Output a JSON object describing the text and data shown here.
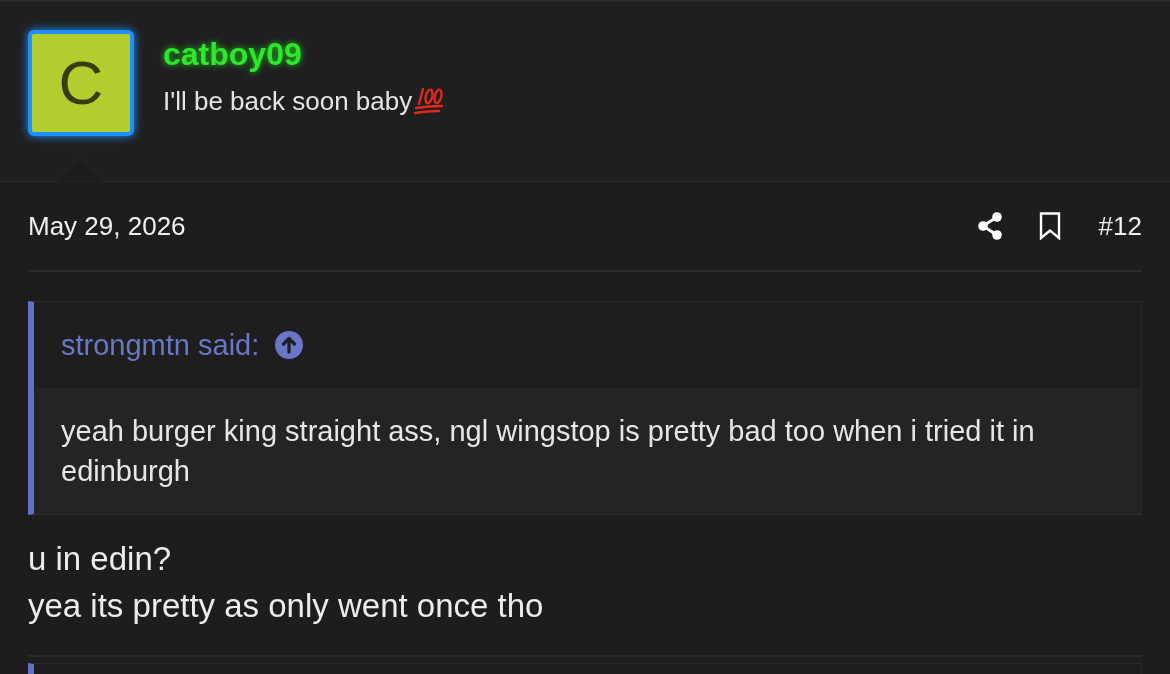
{
  "post": {
    "author": {
      "avatar_letter": "C",
      "username": "catboy09",
      "status": "I'll be back soon baby"
    },
    "date": "May 29, 2026",
    "post_number": "#12",
    "quote": {
      "author_line": "strongmtn said:",
      "text": "yeah burger king straight ass, ngl wingstop is pretty bad too when i tried it in edinburgh"
    },
    "message_lines": [
      "u in edin?",
      "yea its pretty as only went once tho"
    ]
  }
}
